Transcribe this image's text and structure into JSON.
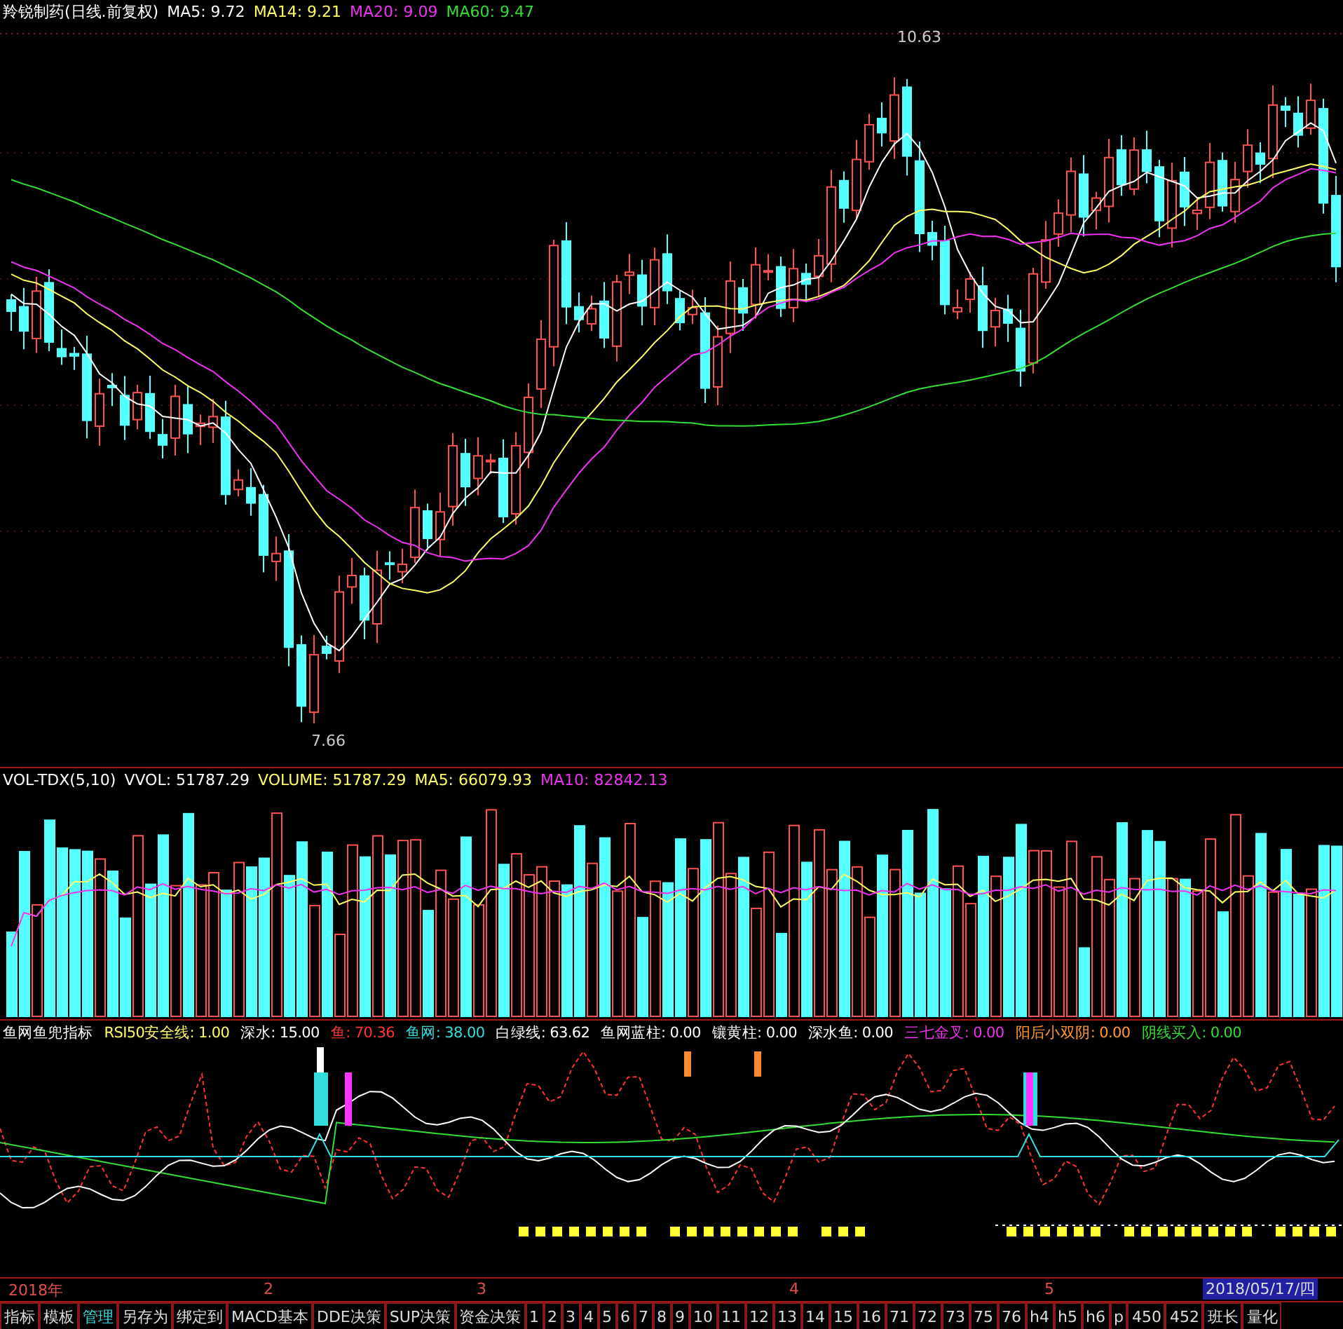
{
  "price_panel": {
    "legend": [
      {
        "text": "羚锐制药(日线.前复权)",
        "color": "#ffffff"
      },
      {
        "text": "MA5: 9.72",
        "color": "#ffffff"
      },
      {
        "text": "MA14: 9.21",
        "color": "#ffff66"
      },
      {
        "text": "MA20: 9.09",
        "color": "#ee33ee"
      },
      {
        "text": "MA60: 9.47",
        "color": "#33dd33"
      }
    ],
    "high_label": "10.63",
    "low_label": "7.66"
  },
  "volume_panel": {
    "legend": [
      {
        "text": "VOL-TDX(5,10)",
        "color": "#ffffff"
      },
      {
        "text": "VVOL: 51787.29",
        "color": "#ffffff"
      },
      {
        "text": "VOLUME: 51787.29",
        "color": "#ffff66"
      },
      {
        "text": "MA5: 66079.93",
        "color": "#ffff66"
      },
      {
        "text": "MA10: 82842.13",
        "color": "#ee33ee"
      }
    ]
  },
  "indicator_panel": {
    "legend": [
      {
        "text": "鱼网鱼兜指标",
        "color": "#ffffff"
      },
      {
        "text": "RSI50安全线: 1.00",
        "color": "#ffff66"
      },
      {
        "text": "深水: 15.00",
        "color": "#ffffff"
      },
      {
        "text": "鱼: 70.36",
        "color": "#ff3333"
      },
      {
        "text": "鱼网: 38.00",
        "color": "#33dddd"
      },
      {
        "text": "白绿线: 63.62",
        "color": "#ffffff"
      },
      {
        "text": "鱼网蓝柱: 0.00",
        "color": "#ffffff"
      },
      {
        "text": "镶黄柱: 0.00",
        "color": "#ffffff"
      },
      {
        "text": "深水鱼: 0.00",
        "color": "#ffffff"
      },
      {
        "text": "三七金叉: 0.00",
        "color": "#ee33ee"
      },
      {
        "text": "阳后小双阴: 0.00",
        "color": "#ff9933"
      },
      {
        "text": "阴线买入: 0.00",
        "color": "#33dd33"
      }
    ]
  },
  "date_axis": {
    "labels": [
      "2018年",
      "2",
      "3",
      "4",
      "5"
    ],
    "cursor_date": "2018/05/17/四"
  },
  "tabs": [
    {
      "label": "指标",
      "selected": false
    },
    {
      "label": "模板",
      "selected": false
    },
    {
      "label": "管理",
      "selected": true
    },
    {
      "label": "另存为",
      "selected": false
    },
    {
      "label": "绑定到",
      "selected": false
    },
    {
      "label": "MACD基本",
      "selected": false
    },
    {
      "label": "DDE决策",
      "selected": false
    },
    {
      "label": "SUP决策",
      "selected": false
    },
    {
      "label": "资金决策",
      "selected": false
    },
    {
      "label": "1",
      "selected": false
    },
    {
      "label": "2",
      "selected": false
    },
    {
      "label": "3",
      "selected": false
    },
    {
      "label": "4",
      "selected": false
    },
    {
      "label": "5",
      "selected": false
    },
    {
      "label": "6",
      "selected": false
    },
    {
      "label": "7",
      "selected": false
    },
    {
      "label": "8",
      "selected": false
    },
    {
      "label": "9",
      "selected": false
    },
    {
      "label": "10",
      "selected": false
    },
    {
      "label": "11",
      "selected": false
    },
    {
      "label": "12",
      "selected": false
    },
    {
      "label": "13",
      "selected": false
    },
    {
      "label": "14",
      "selected": false
    },
    {
      "label": "15",
      "selected": false
    },
    {
      "label": "16",
      "selected": false
    },
    {
      "label": "71",
      "selected": false
    },
    {
      "label": "72",
      "selected": false
    },
    {
      "label": "73",
      "selected": false
    },
    {
      "label": "75",
      "selected": false
    },
    {
      "label": "76",
      "selected": false
    },
    {
      "label": "h4",
      "selected": false
    },
    {
      "label": "h5",
      "selected": false
    },
    {
      "label": "h6",
      "selected": false
    },
    {
      "label": "p",
      "selected": false
    },
    {
      "label": "450",
      "selected": false
    },
    {
      "label": "452",
      "selected": false
    },
    {
      "label": "班长",
      "selected": false
    },
    {
      "label": "量化",
      "selected": false
    }
  ]
}
